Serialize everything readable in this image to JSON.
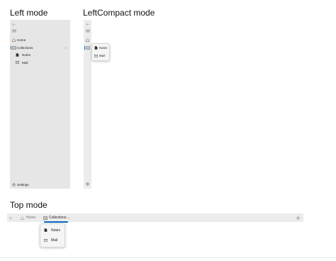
{
  "sections": {
    "left_title": "Left mode",
    "compact_title": "LeftCompact mode",
    "top_title": "Top mode"
  },
  "left_mode": {
    "home": "Home",
    "collections": "Collections",
    "notes": "Notes",
    "mail": "Mail",
    "settings": "Settings"
  },
  "compact_mode": {
    "notes": "Notes",
    "mail": "Mail"
  },
  "top_mode": {
    "home": "Home",
    "collections": "Collections",
    "notes": "Notes",
    "mail": "Mail"
  },
  "colors": {
    "accent": "#0067c0",
    "pane": "#e6e6e6"
  }
}
